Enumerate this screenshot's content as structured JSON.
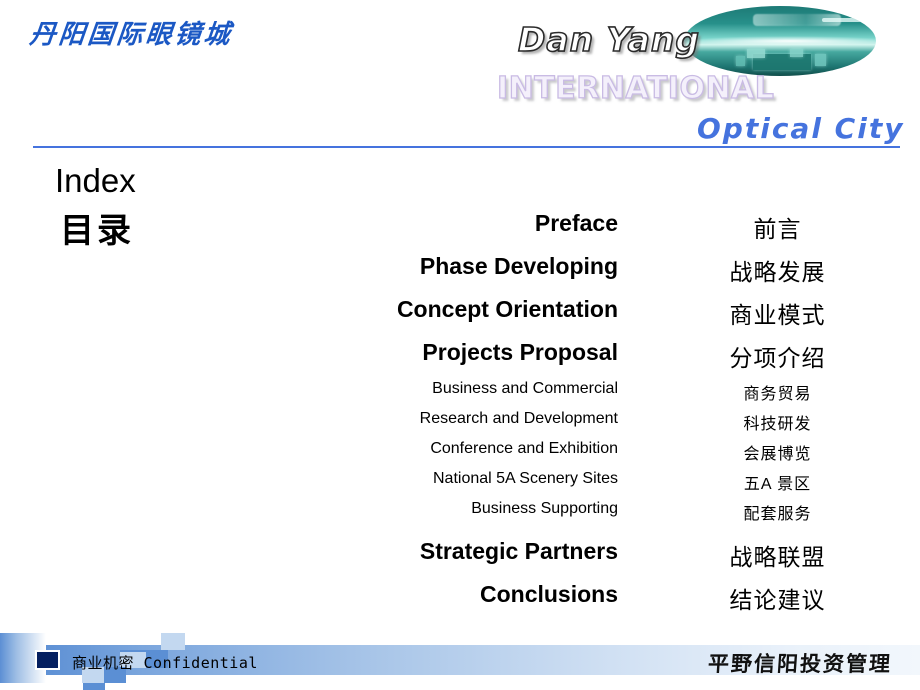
{
  "header": {
    "logo_cn": "丹阳国际眼镜城",
    "brand_line1": "Dan Yang",
    "brand_line2": "INTERNATIONAL",
    "brand_line3": "Optical City",
    "accent_color": "#4573de",
    "oval_color": "#1d7a76"
  },
  "index": {
    "title_en": "Index",
    "title_cn": "目录"
  },
  "toc": {
    "items": [
      {
        "level": "main",
        "en": "Preface",
        "cn": "前言"
      },
      {
        "level": "main",
        "en": "Phase Developing",
        "cn": "战略发展"
      },
      {
        "level": "main",
        "en": "Concept Orientation",
        "cn": "商业模式"
      },
      {
        "level": "main",
        "en": "Projects Proposal",
        "cn": "分项介绍"
      },
      {
        "level": "sub",
        "en": "Business and Commercial",
        "cn": "商务贸易"
      },
      {
        "level": "sub",
        "en": "Research and Development",
        "cn": "科技研发"
      },
      {
        "level": "sub",
        "en": "Conference and Exhibition",
        "cn": "会展博览"
      },
      {
        "level": "sub",
        "en": "National 5A Scenery Sites",
        "cn": "五A 景区"
      },
      {
        "level": "sub",
        "en": "Business Supporting",
        "cn": "配套服务"
      },
      {
        "level": "main",
        "en": "Strategic Partners",
        "cn": "战略联盟"
      },
      {
        "level": "main",
        "en": "Conclusions",
        "cn": "结论建议"
      }
    ]
  },
  "footer": {
    "left_text": "商业机密 Confidential",
    "right_text": "平野信阳投资管理",
    "bar_color_start": "#5c8fd4",
    "bar_color_end": "#f2f7fc",
    "navy_square_color": "#062060"
  }
}
